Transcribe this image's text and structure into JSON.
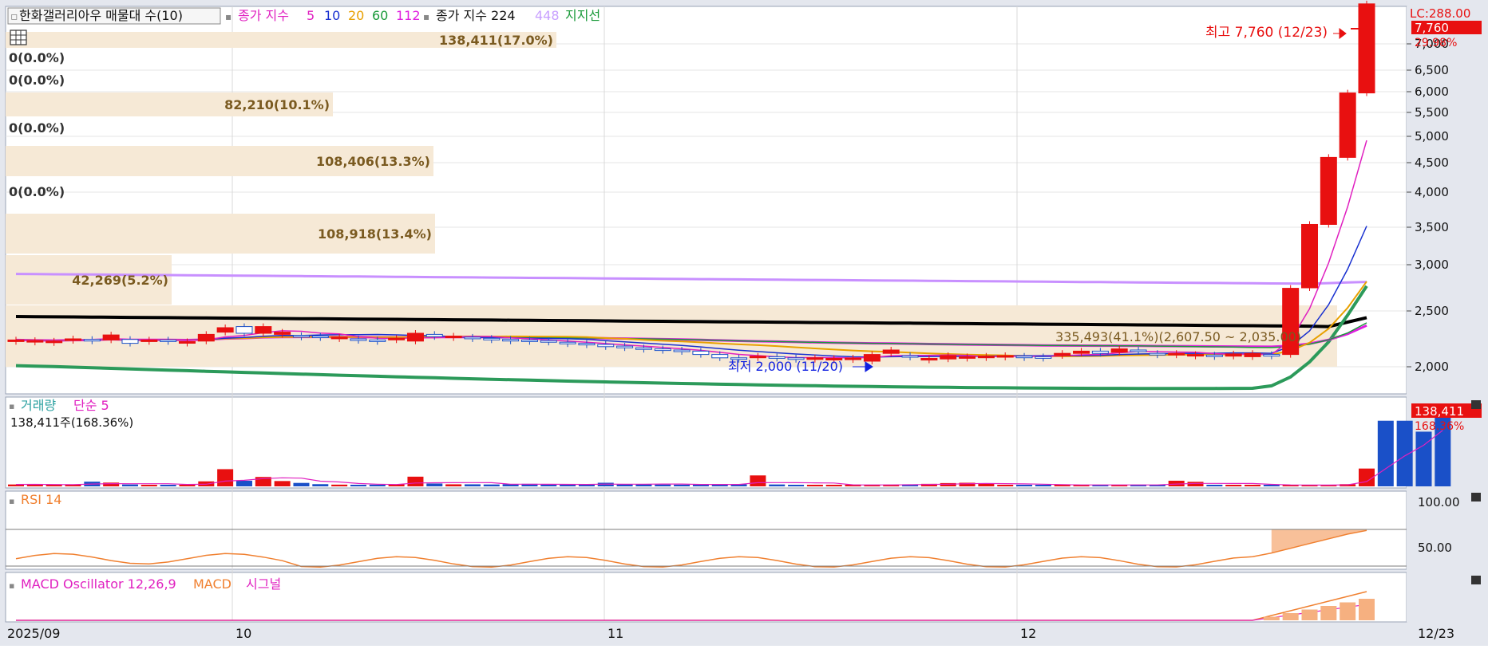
{
  "main_legend": {
    "title": "한화갤러리아우 매물대 수(10)",
    "ma_label": "종가 지수",
    "ma_periods": [
      "5",
      "10",
      "20",
      "60",
      "112"
    ],
    "ma_colors": [
      "#e020c0",
      "#1830d0",
      "#e8a000",
      "#1a9a3a",
      "#e020e0"
    ],
    "ma2_label": "종가 지수 224",
    "ma2_extra": "448",
    "support_label": "지지선"
  },
  "price_axis": {
    "ticks": [
      "7,000",
      "6,500",
      "6,000",
      "5,500",
      "5,000",
      "4,500",
      "4,000",
      "3,500",
      "3,000",
      "2,500",
      "2,000"
    ],
    "top_label": "LC:288.00",
    "current_price": "7,760",
    "current_change": "29.98%"
  },
  "annotations": {
    "high": "최고 7,760 (12/23)",
    "low": "최저 2,000 (11/20)",
    "range_label": "335,493(41.1%)(2,607.50 ~ 2,035.00)"
  },
  "volume_profile": [
    {
      "label": "138,411(17.0%)"
    },
    {
      "label": "0(0.0%)"
    },
    {
      "label": "0(0.0%)"
    },
    {
      "label": "82,210(10.1%)"
    },
    {
      "label": "0(0.0%)"
    },
    {
      "label": "108,406(13.3%)"
    },
    {
      "label": "0(0.0%)"
    },
    {
      "label": "108,918(13.4%)"
    },
    {
      "label": "42,269(5.2%)"
    }
  ],
  "volume_panel": {
    "title": "거래량",
    "ma_label": "단순 5",
    "value_text": "138,411주(168.36%)",
    "badge_value": "138,411",
    "badge_pct": "168.36%"
  },
  "rsi_panel": {
    "title": "RSI 14",
    "ticks": [
      "100.00",
      "50.00"
    ]
  },
  "macd_panel": {
    "title": "MACD Oscillator 12,26,9",
    "macd_label": "MACD",
    "signal_label": "시그널"
  },
  "time_axis": {
    "labels": [
      "2025/09",
      "10",
      "11",
      "12"
    ],
    "right_label": "12/23"
  },
  "chart_data": {
    "type": "candlestick",
    "candles": [
      {
        "o": 2230,
        "c": 2240
      },
      {
        "o": 2225,
        "c": 2235
      },
      {
        "o": 2230,
        "c": 2230
      },
      {
        "o": 2240,
        "c": 2250
      },
      {
        "o": 2245,
        "c": 2240
      },
      {
        "o": 2240,
        "c": 2285
      },
      {
        "o": 2245,
        "c": 2210
      },
      {
        "o": 2235,
        "c": 2240
      },
      {
        "o": 2240,
        "c": 2235
      },
      {
        "o": 2220,
        "c": 2225
      },
      {
        "o": 2230,
        "c": 2290
      },
      {
        "o": 2310,
        "c": 2350
      },
      {
        "o": 2360,
        "c": 2300
      },
      {
        "o": 2300,
        "c": 2360
      },
      {
        "o": 2290,
        "c": 2310
      },
      {
        "o": 2280,
        "c": 2270
      },
      {
        "o": 2275,
        "c": 2270
      },
      {
        "o": 2255,
        "c": 2265
      },
      {
        "o": 2250,
        "c": 2240
      },
      {
        "o": 2240,
        "c": 2235
      },
      {
        "o": 2245,
        "c": 2255
      },
      {
        "o": 2230,
        "c": 2300
      },
      {
        "o": 2290,
        "c": 2270
      },
      {
        "o": 2260,
        "c": 2275
      },
      {
        "o": 2265,
        "c": 2260
      },
      {
        "o": 2255,
        "c": 2250
      },
      {
        "o": 2245,
        "c": 2240
      },
      {
        "o": 2240,
        "c": 2230
      },
      {
        "o": 2235,
        "c": 2220
      },
      {
        "o": 2220,
        "c": 2210
      },
      {
        "o": 2210,
        "c": 2200
      },
      {
        "o": 2200,
        "c": 2180
      },
      {
        "o": 2185,
        "c": 2170
      },
      {
        "o": 2170,
        "c": 2165
      },
      {
        "o": 2160,
        "c": 2150
      },
      {
        "o": 2150,
        "c": 2140
      },
      {
        "o": 2140,
        "c": 2110
      },
      {
        "o": 2110,
        "c": 2080
      },
      {
        "o": 2080,
        "c": 2075
      },
      {
        "o": 2090,
        "c": 2095
      },
      {
        "o": 2090,
        "c": 2085
      },
      {
        "o": 2080,
        "c": 2075
      },
      {
        "o": 2075,
        "c": 2080
      },
      {
        "o": 2070,
        "c": 2075
      },
      {
        "o": 2072,
        "c": 2078
      },
      {
        "o": 2050,
        "c": 2110
      },
      {
        "o": 2120,
        "c": 2150
      },
      {
        "o": 2100,
        "c": 2095
      },
      {
        "o": 2060,
        "c": 2075
      },
      {
        "o": 2070,
        "c": 2100
      },
      {
        "o": 2080,
        "c": 2090
      },
      {
        "o": 2085,
        "c": 2095
      },
      {
        "o": 2090,
        "c": 2100
      },
      {
        "o": 2095,
        "c": 2090
      },
      {
        "o": 2090,
        "c": 2085
      },
      {
        "o": 2100,
        "c": 2120
      },
      {
        "o": 2120,
        "c": 2140
      },
      {
        "o": 2140,
        "c": 2120
      },
      {
        "o": 2130,
        "c": 2160
      },
      {
        "o": 2150,
        "c": 2145
      },
      {
        "o": 2120,
        "c": 2115
      },
      {
        "o": 2110,
        "c": 2120
      },
      {
        "o": 2100,
        "c": 2110
      },
      {
        "o": 2105,
        "c": 2100
      },
      {
        "o": 2095,
        "c": 2115
      },
      {
        "o": 2090,
        "c": 2120
      },
      {
        "o": 2110,
        "c": 2105
      },
      {
        "o": 2110,
        "c": 2745
      },
      {
        "o": 2750,
        "c": 3540
      },
      {
        "o": 3540,
        "c": 4600
      },
      {
        "o": 4600,
        "c": 5970
      },
      {
        "o": 5970,
        "c": 7760
      }
    ],
    "volume": [
      12000,
      14000,
      9000,
      9000,
      30000,
      24000,
      12000,
      9000,
      8000,
      9000,
      32000,
      110000,
      36000,
      60000,
      34000,
      22000,
      14000,
      11000,
      10000,
      11000,
      13000,
      62000,
      18000,
      13000,
      13000,
      12000,
      14000,
      16000,
      12000,
      9000,
      11000,
      23000,
      13000,
      14000,
      12000,
      11000,
      11000,
      13000,
      13000,
      70000,
      12000,
      10000,
      8000,
      8000,
      11000,
      9000,
      11000,
      13000,
      16000,
      21000,
      23000,
      19000,
      8000,
      8000,
      10000,
      11000,
      8000,
      8000,
      9000,
      11000,
      9000,
      36000,
      29000,
      10000,
      9000,
      8000,
      9000,
      9000,
      8000,
      8000,
      14000,
      114000,
      420000,
      420000,
      350000,
      490000
    ],
    "ylim": [
      1800,
      7760
    ]
  }
}
